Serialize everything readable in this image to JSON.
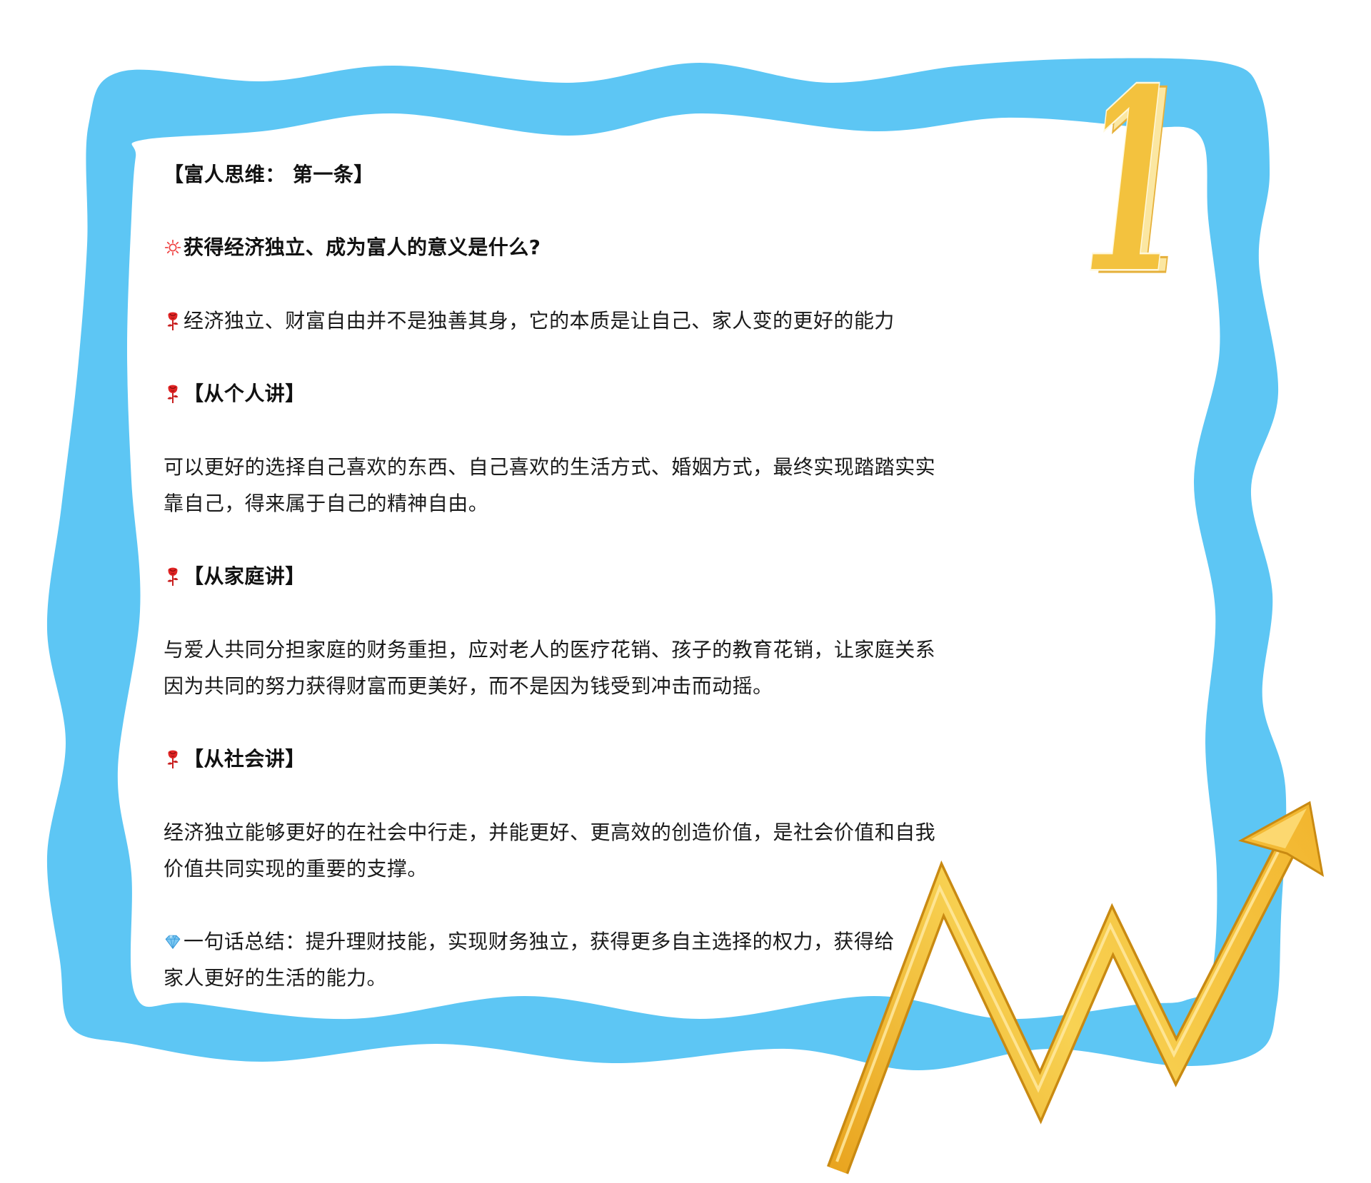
{
  "title": "【富人思维： 第一条】",
  "question": {
    "icon": "sun-icon",
    "text": "获得经济独立、成为富人的意义是什么?"
  },
  "intro": {
    "icon": "rose-icon",
    "text": "经济独立、财富自由并不是独善其身，它的本质是让自己、家人变的更好的能力"
  },
  "sections": [
    {
      "icon": "rose-icon",
      "heading": "【从个人讲】",
      "lines": [
        "可以更好的选择自己喜欢的东西、自己喜欢的生活方式、婚姻方式，最终实现踏踏实实",
        "靠自己，得来属于自己的精神自由。"
      ]
    },
    {
      "icon": "rose-icon",
      "heading": "【从家庭讲】",
      "lines": [
        "与爱人共同分担家庭的财务重担，应对老人的医疗花销、孩子的教育花销，让家庭关系",
        "因为共同的努力获得财富而更美好，而不是因为钱受到冲击而动摇。"
      ]
    },
    {
      "icon": "rose-icon",
      "heading": "【从社会讲】",
      "lines": [
        "经济独立能够更好的在社会中行走，并能更好、更高效的创造价值，是社会价值和自我",
        "价值共同实现的重要的支撑。"
      ]
    }
  ],
  "summary": {
    "icon": "diamond-icon",
    "lines": [
      "一句话总结：提升理财技能，实现财务独立，获得更多自主选择的权力，获得给",
      "家人更好的生活的能力。"
    ]
  },
  "decoration": {
    "badge_number": "1",
    "arrow_icon": "rising-zigzag-arrow-icon"
  },
  "colors": {
    "frame": "#5DC6F4",
    "gold": "#F3C23E",
    "gold_dark": "#D38F14",
    "text": "#1a1a1a",
    "rose": "#D81E1E",
    "sun": "#EF4444",
    "diamond": "#7CC8F2"
  }
}
